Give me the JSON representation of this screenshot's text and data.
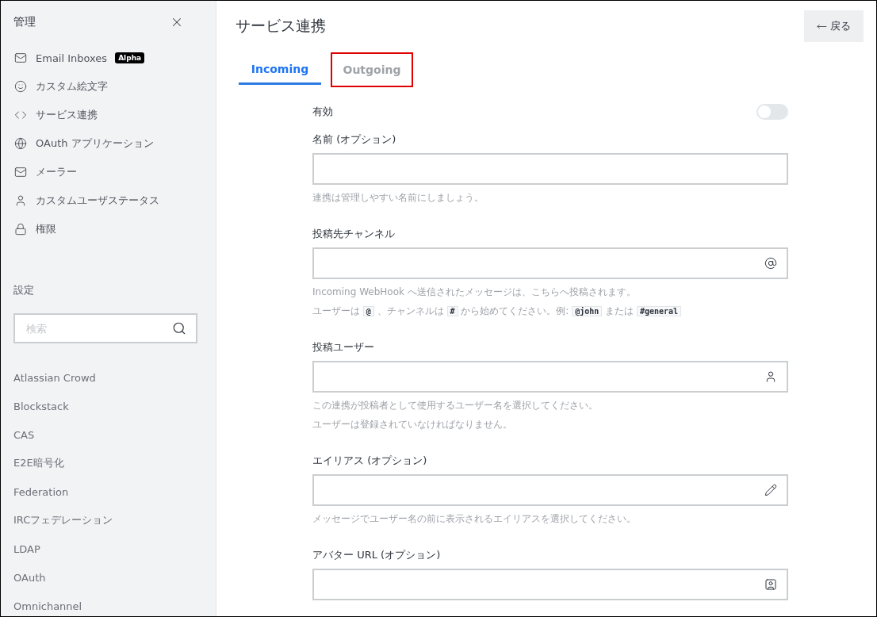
{
  "sidebar": {
    "title": "管理",
    "admin_items": [
      {
        "label": "Email Inboxes",
        "badge": "Alpha"
      },
      {
        "label": "カスタム絵文字"
      },
      {
        "label": "サービス連携"
      },
      {
        "label": "OAuth アプリケーション"
      },
      {
        "label": "メーラー"
      },
      {
        "label": "カスタムユーザステータス"
      },
      {
        "label": "権限"
      }
    ],
    "settings_title": "設定",
    "search": {
      "placeholder": "検索"
    },
    "settings_items": [
      "Atlassian Crowd",
      "Blockstack",
      "CAS",
      "E2E暗号化",
      "Federation",
      "IRCフェデレーション",
      "LDAP",
      "OAuth",
      "Omnichannel"
    ]
  },
  "main": {
    "title": "サービス連携",
    "back_button": "戻る",
    "tabs": [
      {
        "label": "Incoming",
        "selected": true,
        "highlighted": false
      },
      {
        "label": "Outgoing",
        "selected": false,
        "highlighted": true
      }
    ],
    "form": [
      {
        "kind": "toggle",
        "label": "有効",
        "on": false
      },
      {
        "kind": "input",
        "label": "名前 (オプション)",
        "hints": [
          [
            {
              "text": "連携は管理しやすい名前にしましょう。"
            }
          ]
        ]
      },
      {
        "kind": "input",
        "label": "投稿先チャンネル",
        "hints": [
          [
            {
              "text": "Incoming WebHook へ送信されたメッセージは、こちらへ投稿されます。"
            }
          ],
          [
            {
              "text": "ユーザーは "
            },
            {
              "code": "@"
            },
            {
              "text": " 、チャンネルは "
            },
            {
              "code": "#"
            },
            {
              "text": " から始めてください。例: "
            },
            {
              "code": "@john"
            },
            {
              "text": " または "
            },
            {
              "code": "#general"
            }
          ]
        ]
      },
      {
        "kind": "input",
        "label": "投稿ユーザー",
        "hints": [
          [
            {
              "text": "この連携が投稿者として使用するユーザー名を選択してください。"
            }
          ],
          [
            {
              "text": "ユーザーは登録されていなければなりません。"
            }
          ]
        ]
      },
      {
        "kind": "input",
        "label": "エイリアス (オプション)",
        "hints": [
          [
            {
              "text": "メッセージでユーザー名の前に表示されるエイリアスを選択してください。"
            }
          ]
        ]
      },
      {
        "kind": "input",
        "label": "アバター URL (オプション)"
      }
    ]
  }
}
